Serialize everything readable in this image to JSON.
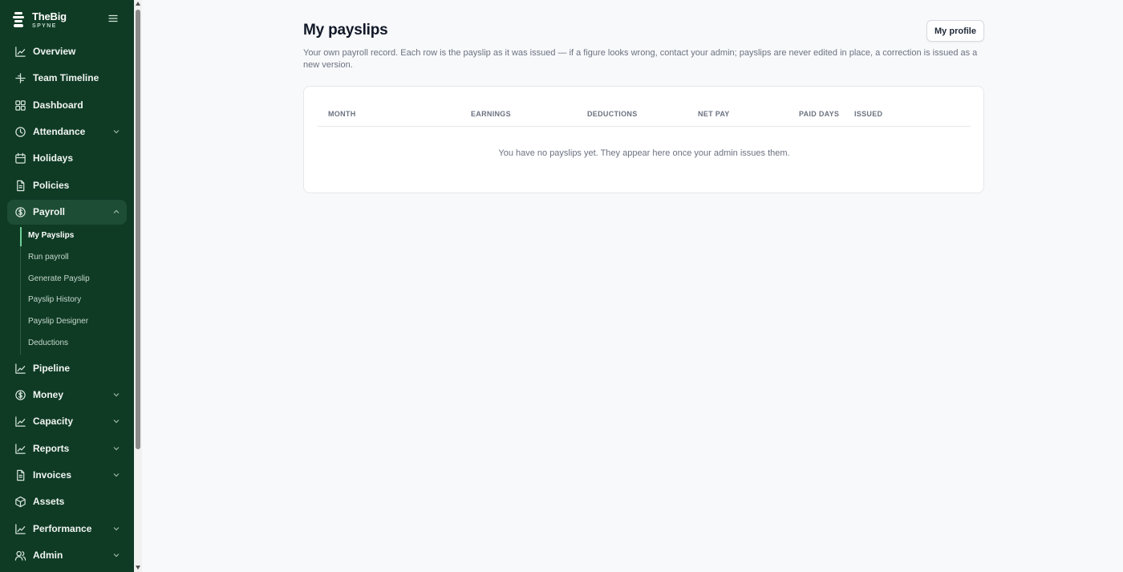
{
  "brand": {
    "name": "TheBig",
    "subtitle": "SPYNE"
  },
  "nav": {
    "overview": "Overview",
    "team_timeline": "Team Timeline",
    "dashboard": "Dashboard",
    "attendance": "Attendance",
    "holidays": "Holidays",
    "policies": "Policies",
    "payroll": "Payroll",
    "pipeline": "Pipeline",
    "money": "Money",
    "capacity": "Capacity",
    "reports": "Reports",
    "invoices": "Invoices",
    "assets": "Assets",
    "performance": "Performance",
    "admin": "Admin"
  },
  "payroll_sub": {
    "my_payslips": "My Payslips",
    "run_payroll": "Run payroll",
    "generate_payslip": "Generate Payslip",
    "payslip_history": "Payslip History",
    "payslip_designer": "Payslip Designer",
    "deductions": "Deductions"
  },
  "page": {
    "title": "My payslips",
    "profile_button": "My profile",
    "description": "Your own payroll record. Each row is the payslip as it was issued — if a figure looks wrong, contact your admin; payslips are never edited in place, a correction is issued as a new version."
  },
  "table": {
    "columns": [
      "MONTH",
      "EARNINGS",
      "DEDUCTIONS",
      "NET PAY",
      "PAID DAYS",
      "ISSUED"
    ],
    "rows": [],
    "empty_message": "You have no payslips yet. They appear here once your admin issues them."
  },
  "colors": {
    "sidebar_bg": "#0f3b25",
    "sidebar_active": "#1d4d35",
    "active_indicator": "#6fcf97",
    "page_bg": "#f8f9fb"
  }
}
